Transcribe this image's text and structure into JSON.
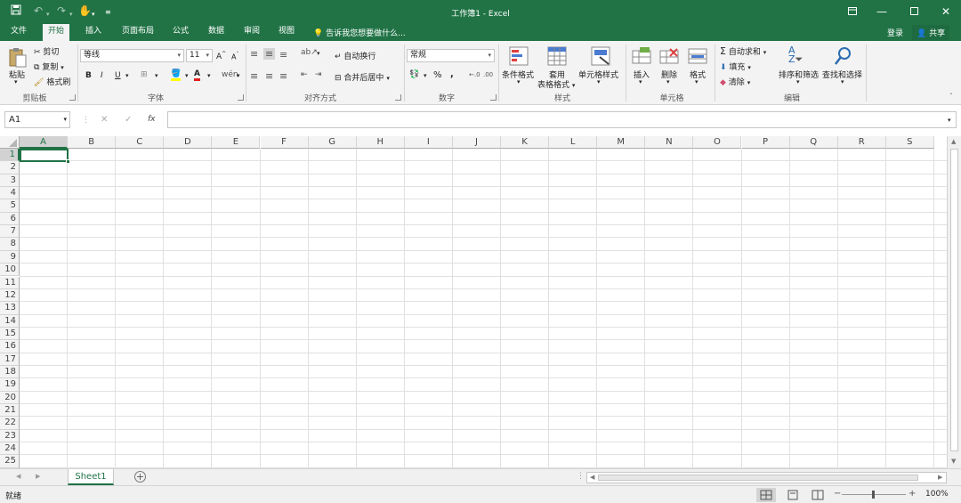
{
  "titlebar": {
    "title": "工作簿1 - Excel"
  },
  "tabs": [
    "文件",
    "开始",
    "插入",
    "页面布局",
    "公式",
    "数据",
    "审阅",
    "视图"
  ],
  "active_tab": "开始",
  "tellme": "告诉我您想要做什么...",
  "login": "登录",
  "share": "共享",
  "ribbon": {
    "clipboard": {
      "paste": "粘贴",
      "cut": "剪切",
      "copy": "复制",
      "format_painter": "格式刷",
      "label": "剪贴板"
    },
    "font": {
      "font_name": "等线",
      "font_size": "11",
      "bold": "B",
      "italic": "I",
      "underline": "U",
      "label": "字体"
    },
    "alignment": {
      "wrap_text": "自动换行",
      "merge_center": "合并后居中",
      "label": "对齐方式"
    },
    "number": {
      "format": "常规",
      "percent": "%",
      "comma": ",",
      "label": "数字"
    },
    "styles": {
      "conditional": "条件格式",
      "table_a": "套用",
      "table_b": "表格格式",
      "cell_styles": "单元格样式",
      "label": "样式"
    },
    "cells": {
      "insert": "插入",
      "delete": "删除",
      "format": "格式",
      "label": "单元格"
    },
    "editing": {
      "autosum": "自动求和",
      "fill": "填充",
      "clear": "清除",
      "sort_filter": "排序和筛选",
      "find_select": "查找和选择",
      "label": "编辑"
    }
  },
  "formula_bar": {
    "name_box": "A1",
    "fx": "fx",
    "formula": ""
  },
  "grid": {
    "columns": [
      "A",
      "B",
      "C",
      "D",
      "E",
      "F",
      "G",
      "H",
      "I",
      "J",
      "K",
      "L",
      "M",
      "N",
      "O",
      "P",
      "Q",
      "R",
      "S"
    ],
    "rows": [
      "1",
      "2",
      "3",
      "4",
      "5",
      "6",
      "7",
      "8",
      "9",
      "10",
      "11",
      "12",
      "13",
      "14",
      "15",
      "16",
      "17",
      "18",
      "19",
      "20",
      "21",
      "22",
      "23",
      "24",
      "25"
    ],
    "selected_cell": "A1"
  },
  "sheets": [
    "Sheet1"
  ],
  "status": {
    "ready": "就绪",
    "zoom": "100%"
  },
  "colors": {
    "accent": "#217346",
    "ribbon_bg": "#f3f3f3",
    "grid_line": "#e1e1e1"
  }
}
